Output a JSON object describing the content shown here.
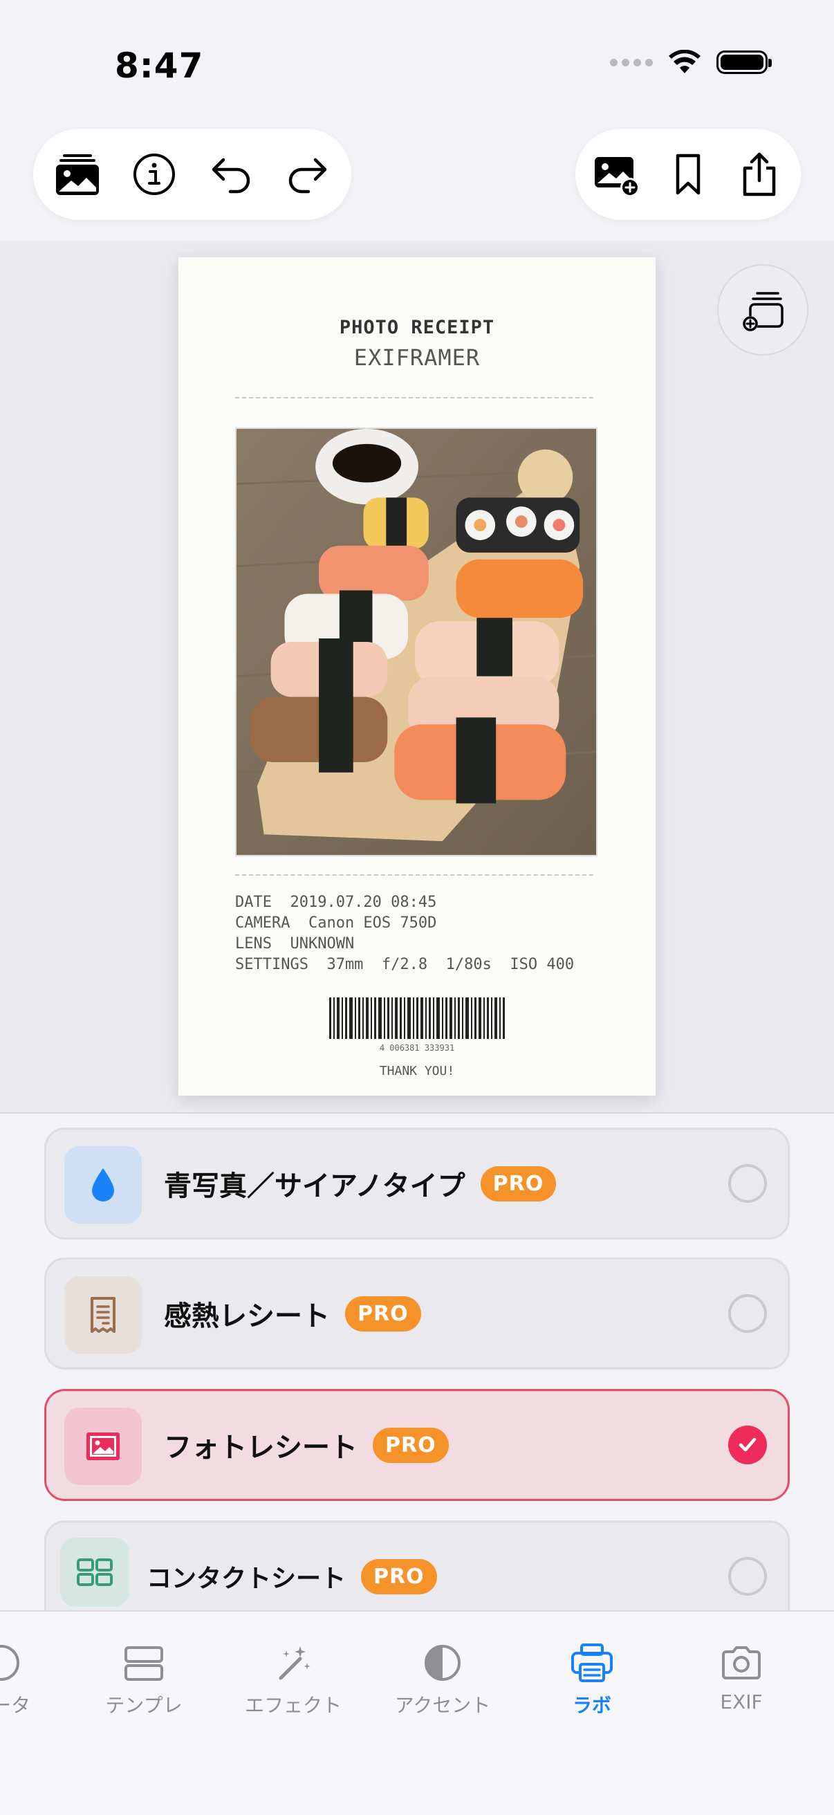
{
  "status_bar": {
    "time": "8:47"
  },
  "toolbar_left": {
    "buttons": [
      {
        "icon": "photo-library-icon"
      },
      {
        "icon": "info-icon"
      },
      {
        "icon": "undo-icon"
      },
      {
        "icon": "redo-icon"
      }
    ]
  },
  "toolbar_right": {
    "buttons": [
      {
        "icon": "add-photo-icon"
      },
      {
        "icon": "bookmark-icon"
      },
      {
        "icon": "share-icon"
      }
    ]
  },
  "receipt": {
    "title": "PHOTO RECEIPT",
    "brand": "EXIFRAMER",
    "date_line": "DATE  2019.07.20 08:45",
    "camera_line": "CAMERA  Canon EOS 750D",
    "lens_line": "LENS  UNKNOWN",
    "settings_line": "SETTINGS  37mm  f/2.8  1/80s  ISO 400",
    "barcode_number": "4 006381 333931",
    "thanks": "THANK YOU!"
  },
  "options": [
    {
      "label": "青写真／サイアノタイプ",
      "badge": "PRO",
      "selected": false,
      "icon": "water-drop-icon",
      "icon_bg": "#cfe0f4",
      "icon_color": "#1a82f7"
    },
    {
      "label": "感熱レシート",
      "badge": "PRO",
      "selected": false,
      "icon": "receipt-icon",
      "icon_bg": "#e6dfda",
      "icon_color": "#9b6e4e"
    },
    {
      "label": "フォトレシート",
      "badge": "PRO",
      "selected": true,
      "icon": "photo-frame-icon",
      "icon_bg": "#f3c5d1",
      "icon_color": "#ee2c5b"
    },
    {
      "label": "コンタクトシート",
      "badge": "PRO",
      "selected": false,
      "icon": "grid-icon",
      "icon_bg": "#d6e7e1",
      "icon_color": "#3a9b78"
    }
  ],
  "tabs": [
    {
      "label": "データ",
      "icon": "data-icon",
      "active": false
    },
    {
      "label": "テンプレ",
      "icon": "template-icon",
      "active": false
    },
    {
      "label": "エフェクト",
      "icon": "magic-wand-icon",
      "active": false
    },
    {
      "label": "アクセント",
      "icon": "contrast-icon",
      "active": false
    },
    {
      "label": "ラボ",
      "icon": "printer-icon",
      "active": true
    },
    {
      "label": "EXIF",
      "icon": "camera-icon",
      "active": false
    }
  ],
  "colors": {
    "accent": "#1a82f7",
    "selected": "#ee2c5b",
    "pro_badge": "#f5922a"
  }
}
